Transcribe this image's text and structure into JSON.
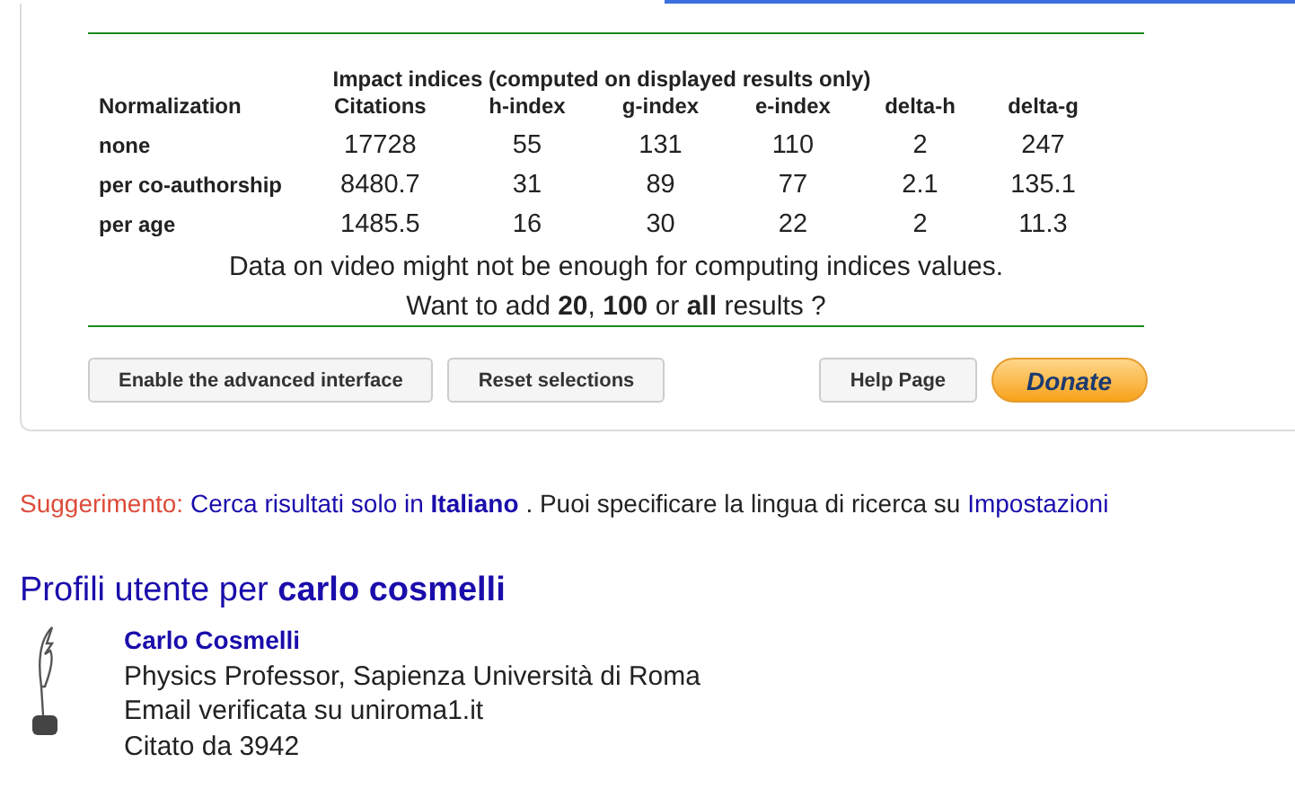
{
  "indices": {
    "title": "Impact indices (computed on displayed results only)",
    "columns": [
      "Normalization",
      "Citations",
      "h-index",
      "g-index",
      "e-index",
      "delta-h",
      "delta-g"
    ],
    "rows": [
      [
        "none",
        "17728",
        "55",
        "131",
        "110",
        "2",
        "247"
      ],
      [
        "per co-authorship",
        "8480.7",
        "31",
        "89",
        "77",
        "2.1",
        "135.1"
      ],
      [
        "per age",
        "1485.5",
        "16",
        "30",
        "22",
        "2",
        "11.3"
      ]
    ],
    "note": "Data on video might not be enough for computing indices values.",
    "add_results": "Want to add **20**, **100** or **all** results ?"
  },
  "buttons": [
    {
      "label": "Enable the advanced interface",
      "kind": "plain"
    },
    {
      "label": "Reset selections",
      "kind": "plain"
    },
    {
      "label": "Help Page",
      "kind": "plain"
    },
    {
      "label": "Donate",
      "kind": "donate"
    }
  ],
  "suggestion": {
    "label": "Suggerimento:",
    "link": "Cerca risultati solo in",
    "language": "Italiano",
    "text": ". Puoi specificare la lingua di ricerca su",
    "settings": "Impostazioni"
  },
  "profiles": {
    "heading": "Profili utente per",
    "query": "carlo cosmelli",
    "items": [
      {
        "name": "Carlo Cosmelli",
        "affiliation": "Physics Professor, Sapienza Università di Roma",
        "email": "Email verificata su uniroma1.it",
        "cited": "Citato da 3942"
      }
    ]
  }
}
